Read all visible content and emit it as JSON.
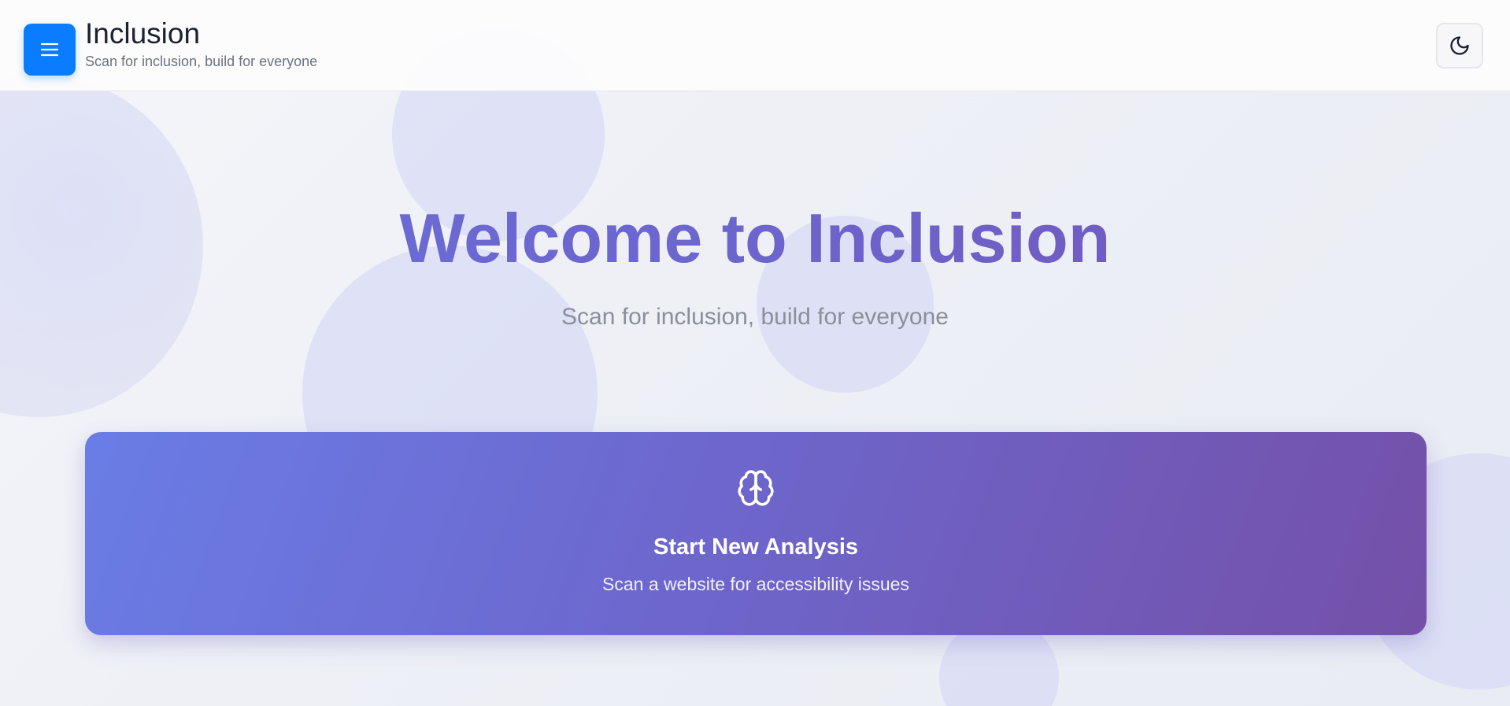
{
  "app": {
    "title": "Inclusion",
    "tagline": "Scan for inclusion, build for everyone"
  },
  "header": {
    "menu_icon": "hamburger-menu-icon",
    "theme_icon": "moon-icon"
  },
  "hero": {
    "title": "Welcome to Inclusion",
    "subtitle": "Scan for inclusion, build for everyone"
  },
  "action_card": {
    "icon": "brain-icon",
    "title": "Start New Analysis",
    "subtitle": "Scan a website for accessibility issues"
  },
  "colors": {
    "accent_blue": "#0a7cff",
    "gradient_start": "#6a7de6",
    "gradient_end": "#7450a8",
    "background": "#eef0f6"
  }
}
